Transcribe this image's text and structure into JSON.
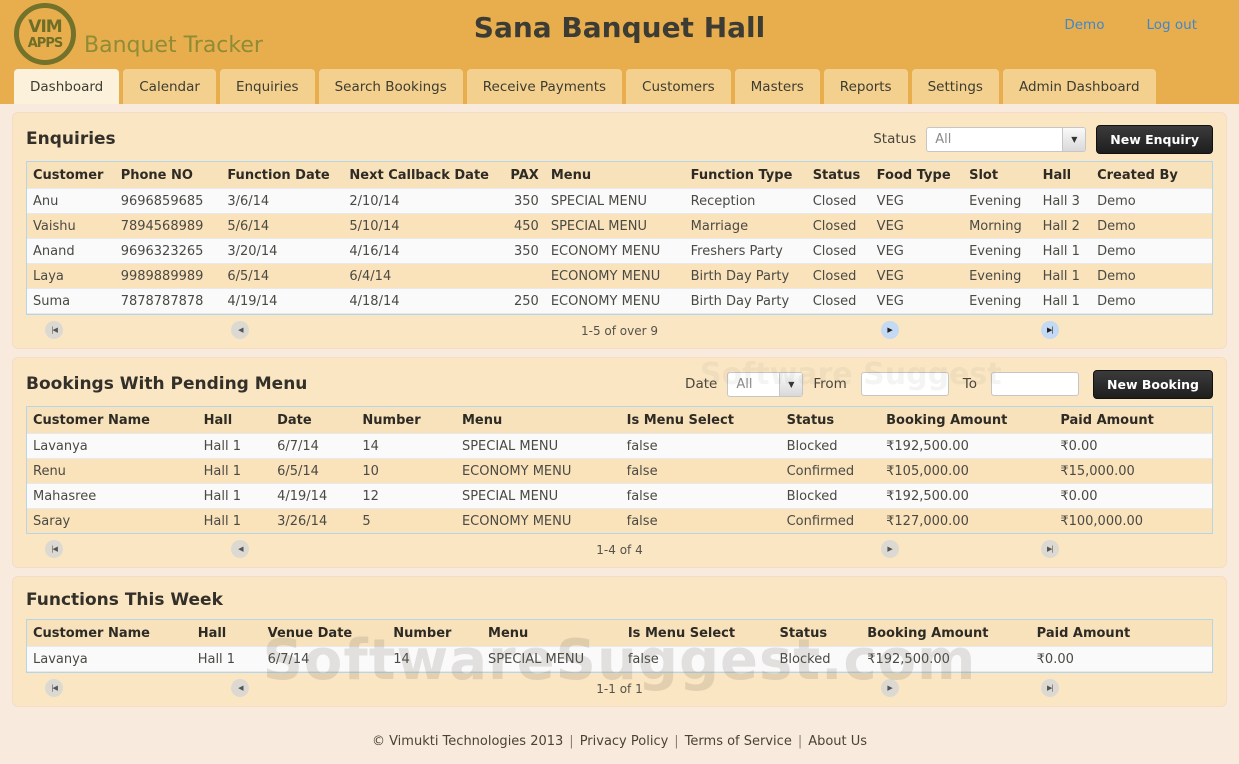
{
  "header": {
    "logo_line1": "VIM",
    "logo_line2": "APPS",
    "brand": "Banquet Tracker",
    "title": "Sana Banquet Hall",
    "user_link": "Demo",
    "logout_link": "Log out"
  },
  "tabs": [
    {
      "label": "Dashboard",
      "active": true
    },
    {
      "label": "Calendar",
      "active": false
    },
    {
      "label": "Enquiries",
      "active": false
    },
    {
      "label": "Search Bookings",
      "active": false
    },
    {
      "label": "Receive Payments",
      "active": false
    },
    {
      "label": "Customers",
      "active": false
    },
    {
      "label": "Masters",
      "active": false
    },
    {
      "label": "Reports",
      "active": false
    },
    {
      "label": "Settings",
      "active": false
    },
    {
      "label": "Admin Dashboard",
      "active": false
    }
  ],
  "enquiries": {
    "title": "Enquiries",
    "status_label": "Status",
    "status_value": "All",
    "new_button": "New Enquiry",
    "columns": [
      "Customer",
      "Phone NO",
      "Function Date",
      "Next Callback Date",
      "PAX",
      "Menu",
      "Function Type",
      "Status",
      "Food Type",
      "Slot",
      "Hall",
      "Created By"
    ],
    "rows": [
      [
        "Anu",
        "9696859685",
        "3/6/14",
        "2/10/14",
        "350",
        "SPECIAL MENU",
        "Reception",
        "Closed",
        "VEG",
        "Evening",
        "Hall 3",
        "Demo"
      ],
      [
        "Vaishu",
        "7894568989",
        "5/6/14",
        "5/10/14",
        "450",
        "SPECIAL MENU",
        "Marriage",
        "Closed",
        "VEG",
        "Morning",
        "Hall 2",
        "Demo"
      ],
      [
        "Anand",
        "9696323265",
        "3/20/14",
        "4/16/14",
        "350",
        "ECONOMY MENU",
        "Freshers Party",
        "Closed",
        "VEG",
        "Evening",
        "Hall 1",
        "Demo"
      ],
      [
        "Laya",
        "9989889989",
        "6/5/14",
        "6/4/14",
        "",
        "ECONOMY MENU",
        "Birth Day Party",
        "Closed",
        "VEG",
        "Evening",
        "Hall 1",
        "Demo"
      ],
      [
        "Suma",
        "7878787878",
        "4/19/14",
        "4/18/14",
        "250",
        "ECONOMY MENU",
        "Birth Day Party",
        "Closed",
        "VEG",
        "Evening",
        "Hall 1",
        "Demo"
      ]
    ],
    "pagination": {
      "label": "1-5 of over 9",
      "first": false,
      "prev": false,
      "next": true,
      "last": true
    }
  },
  "bookings": {
    "title": "Bookings With Pending Menu",
    "date_label": "Date",
    "date_value": "All",
    "from_label": "From",
    "to_label": "To",
    "new_button": "New Booking",
    "columns": [
      "Customer Name",
      "Hall",
      "Date",
      "Number",
      "Menu",
      "Is Menu Select",
      "Status",
      "Booking Amount",
      "Paid Amount"
    ],
    "rows": [
      [
        "Lavanya",
        "Hall 1",
        "6/7/14",
        "14",
        "SPECIAL MENU",
        "false",
        "Blocked",
        "₹192,500.00",
        "₹0.00"
      ],
      [
        "Renu",
        "Hall 1",
        "6/5/14",
        "10",
        "ECONOMY MENU",
        "false",
        "Confirmed",
        "₹105,000.00",
        "₹15,000.00"
      ],
      [
        "Mahasree",
        "Hall 1",
        "4/19/14",
        "12",
        "SPECIAL MENU",
        "false",
        "Blocked",
        "₹192,500.00",
        "₹0.00"
      ],
      [
        "Saray",
        "Hall 1",
        "3/26/14",
        "5",
        "ECONOMY MENU",
        "false",
        "Confirmed",
        "₹127,000.00",
        "₹100,000.00"
      ]
    ],
    "pagination": {
      "label": "1-4 of 4",
      "first": false,
      "prev": false,
      "next": false,
      "last": false
    }
  },
  "functions_week": {
    "title": "Functions This Week",
    "columns": [
      "Customer Name",
      "Hall",
      "Venue Date",
      "Number",
      "Menu",
      "Is Menu Select",
      "Status",
      "Booking Amount",
      "Paid Amount"
    ],
    "rows": [
      [
        "Lavanya",
        "Hall 1",
        "6/7/14",
        "14",
        "SPECIAL MENU",
        "false",
        "Blocked",
        "₹192,500.00",
        "₹0.00"
      ]
    ],
    "pagination": {
      "label": "1-1 of 1",
      "first": false,
      "prev": false,
      "next": false,
      "last": false
    }
  },
  "footer": {
    "copyright": "© Vimukti Technologies 2013",
    "links": [
      "Privacy Policy",
      "Terms of Service",
      "About Us"
    ]
  },
  "watermark": "SoftwareSuggest.com",
  "watermark_small": "Software Suggest",
  "icons": {
    "first_page": "|◀",
    "prev_page": "◀",
    "next_page": "▶",
    "last_page": "▶|",
    "dropdown": "▼"
  },
  "colors": {
    "header_gold": "#E8AE4D",
    "tab_inactive": "#F4D08F",
    "tab_active": "#FCF1DB",
    "panel_cream": "#FBE6C3",
    "table_header": "#F8E2BC",
    "row_alt": "#FAE3BB",
    "table_border_blue": "#B5D6E8",
    "link_blue": "#3E86CE",
    "button_dark": "#2D2D2D",
    "logo_olive": "#72722A"
  }
}
